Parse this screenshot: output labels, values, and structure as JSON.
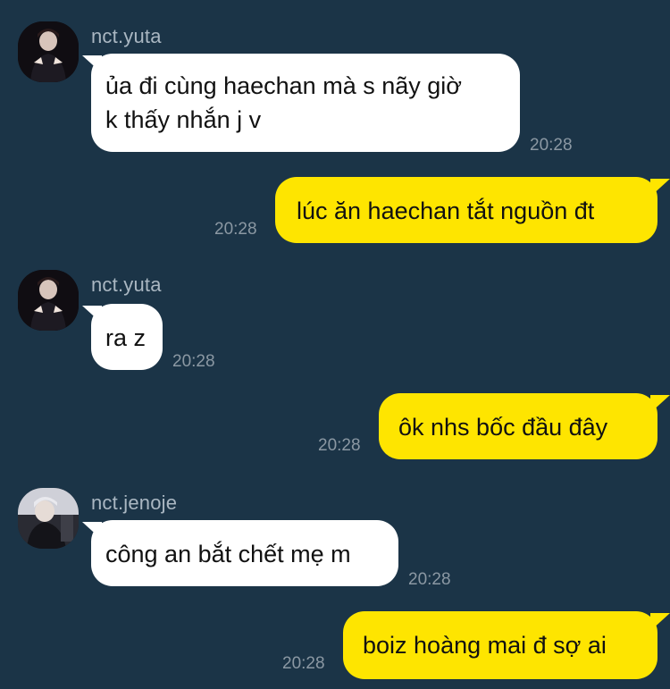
{
  "colors": {
    "background": "#1b3447",
    "incoming_bubble": "#ffffff",
    "outgoing_bubble": "#fee500",
    "sender_name": "#aab7c2",
    "timestamp": "#8b98a3"
  },
  "messages": [
    {
      "direction": "incoming",
      "sender": "nct.yuta",
      "avatar": "avatar-photo",
      "lines": [
        "ủa đi cùng haechan mà s nãy giờ",
        "k thấy nhắn j v"
      ],
      "time": "20:28"
    },
    {
      "direction": "outgoing",
      "lines": [
        "lúc ăn haechan tắt nguồn đt"
      ],
      "time": "20:28"
    },
    {
      "direction": "incoming",
      "sender": "nct.yuta",
      "avatar": "avatar-photo",
      "lines": [
        "ra z"
      ],
      "time": "20:28"
    },
    {
      "direction": "outgoing",
      "lines": [
        "ôk nhs bốc đầu đây"
      ],
      "time": "20:28"
    },
    {
      "direction": "incoming",
      "sender": "nct.jenoje",
      "avatar": "avatar-photo",
      "lines": [
        "công an bắt chết mẹ m"
      ],
      "time": "20:28"
    },
    {
      "direction": "outgoing",
      "lines": [
        "boiz hoàng mai đ sợ ai"
      ],
      "time": "20:28"
    }
  ]
}
